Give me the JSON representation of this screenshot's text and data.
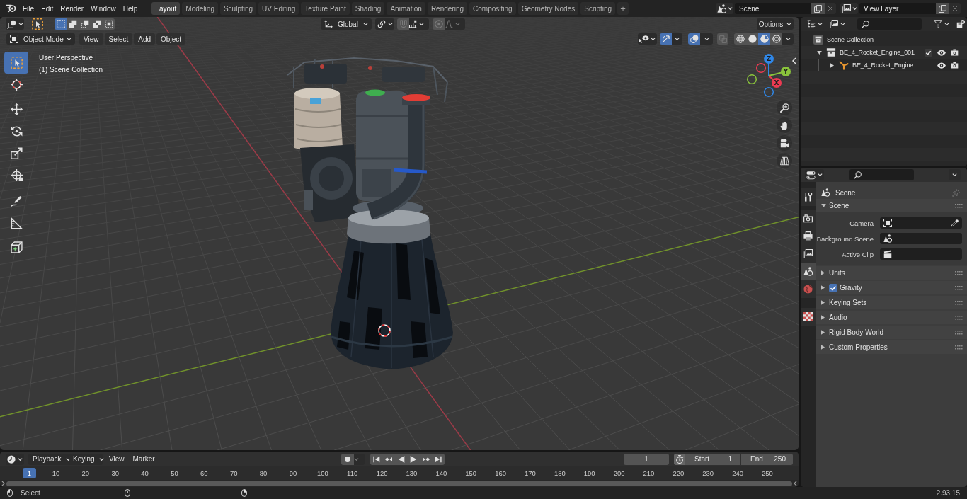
{
  "top_bar": {
    "menus": [
      "File",
      "Edit",
      "Render",
      "Window",
      "Help"
    ],
    "workspaces": [
      {
        "label": "Layout",
        "selected": true
      },
      {
        "label": "Modeling",
        "selected": false
      },
      {
        "label": "Sculpting",
        "selected": false
      },
      {
        "label": "UV Editing",
        "selected": false
      },
      {
        "label": "Texture Paint",
        "selected": false
      },
      {
        "label": "Shading",
        "selected": false
      },
      {
        "label": "Animation",
        "selected": false
      },
      {
        "label": "Rendering",
        "selected": false
      },
      {
        "label": "Compositing",
        "selected": false
      },
      {
        "label": "Geometry Nodes",
        "selected": false
      },
      {
        "label": "Scripting",
        "selected": false
      }
    ],
    "add_workspace": "+",
    "scene": "Scene",
    "view_layer": "View Layer"
  },
  "viewport": {
    "select_modes": [
      {
        "kind": "set",
        "selected": true
      },
      {
        "kind": "extend",
        "selected": false
      },
      {
        "kind": "subtract",
        "selected": false
      },
      {
        "kind": "invert",
        "selected": false
      },
      {
        "kind": "intersect",
        "selected": false
      }
    ],
    "orientation": "Global",
    "snap": false,
    "proportional_editing": false,
    "options": "Options",
    "mode": "Object Mode",
    "menus": [
      "View",
      "Select",
      "Add",
      "Object"
    ],
    "gizmos": true,
    "overlays": true,
    "xray": false,
    "shading": [
      {
        "kind": "wireframe",
        "selected": false
      },
      {
        "kind": "solid",
        "selected": false
      },
      {
        "kind": "material",
        "selected": true
      },
      {
        "kind": "rendered",
        "selected": false
      }
    ],
    "info": [
      "User Perspective",
      "(1) Scene Collection"
    ],
    "tools": [
      {
        "kind": "select_box",
        "selected": true
      },
      {
        "kind": "cursor",
        "selected": false
      },
      {
        "kind": "move",
        "selected": false
      },
      {
        "kind": "rotate",
        "selected": false
      },
      {
        "kind": "scale",
        "selected": false
      },
      {
        "kind": "transform",
        "selected": false
      },
      {
        "kind": "annotate",
        "selected": false
      },
      {
        "kind": "measure",
        "selected": false
      },
      {
        "kind": "add_cube",
        "selected": false
      }
    ],
    "axes": [
      {
        "kind": "z",
        "label": "Z"
      },
      {
        "kind": "y",
        "label": "Y"
      },
      {
        "kind": "x",
        "label": "X"
      }
    ]
  },
  "outliner": {
    "tree": [
      {
        "label": "Scene Collection",
        "kind": "scene_collection",
        "children": [
          {
            "label": "BE_4_Rocket_Engine_001",
            "kind": "collection",
            "expanded": true,
            "checked": true,
            "children": [
              {
                "label": "BE_4_Rocket_Engine",
                "kind": "armature",
                "expanded": false
              }
            ]
          }
        ]
      }
    ]
  },
  "properties": {
    "tabs": [
      {
        "kind": "tool",
        "selected": false
      },
      {
        "kind": "render",
        "selected": false
      },
      {
        "kind": "output",
        "selected": false
      },
      {
        "kind": "view_layer",
        "selected": false
      },
      {
        "kind": "scene",
        "selected": true
      },
      {
        "kind": "world",
        "selected": false
      },
      {
        "kind": "texture",
        "selected": false
      }
    ],
    "context": "Scene",
    "panels": [
      {
        "label": "Scene",
        "expanded": true,
        "fields": [
          {
            "label": "Camera",
            "kind": "object"
          },
          {
            "label": "Background Scene",
            "kind": "scene"
          },
          {
            "label": "Active Clip",
            "kind": "clip"
          }
        ]
      },
      {
        "label": "Units",
        "expanded": false
      },
      {
        "label": "Gravity",
        "expanded": false,
        "checked": true
      },
      {
        "label": "Keying Sets",
        "expanded": false
      },
      {
        "label": "Audio",
        "expanded": false
      },
      {
        "label": "Rigid Body World",
        "expanded": false
      },
      {
        "label": "Custom Properties",
        "expanded": false
      }
    ]
  },
  "timeline": {
    "menus": [
      {
        "label": "Playback",
        "kind": "dropdown"
      },
      {
        "label": "Keying",
        "kind": "dropdown"
      },
      {
        "label": "View",
        "kind": "menu"
      },
      {
        "label": "Marker",
        "kind": "menu"
      }
    ],
    "current_frame": "1",
    "start": {
      "label": "Start",
      "value": "1"
    },
    "end": {
      "label": "End",
      "value": "250"
    },
    "playhead": "1",
    "ruler": [
      "10",
      "20",
      "30",
      "40",
      "50",
      "60",
      "70",
      "80",
      "90",
      "100",
      "110",
      "120",
      "130",
      "140",
      "150",
      "160",
      "170",
      "180",
      "190",
      "200",
      "210",
      "220",
      "230",
      "240",
      "250"
    ]
  },
  "status_bar": {
    "action": "Select",
    "version": "2.93.15"
  }
}
